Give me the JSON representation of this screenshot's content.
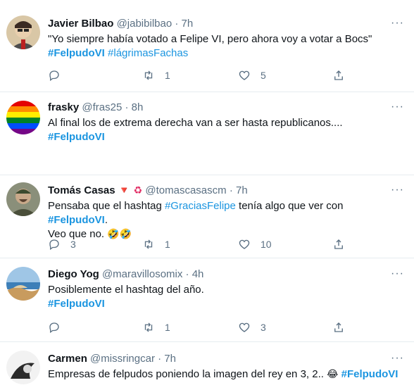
{
  "tweets": [
    {
      "name": "Javier Bilbao",
      "handle": "@jabibilbao",
      "time": "7h",
      "line1": "\"Yo siempre había votado a Felipe VI, pero ahora voy a votar a Bocs\"",
      "tag1": "#FelpudoVI",
      "tag2": "#lágrimasFachas",
      "reply_count": "",
      "retweet_count": "1",
      "like_count": "5"
    },
    {
      "name": "frasky",
      "handle": "@fras25",
      "time": "8h",
      "line1": "Al final los de extrema derecha van a ser hasta republicanos....",
      "tag1": "#FelpudoVI",
      "reply_count": "",
      "retweet_count": "",
      "like_count": ""
    },
    {
      "name": "Tomás Casas",
      "name_emojis": "🔻 ♻",
      "handle": "@tomascasascm",
      "time": "7h",
      "line1_pre": "Pensaba que el hashtag ",
      "tag_mid": "#GraciasFelipe",
      "line1_mid": " tenía algo que ver con ",
      "tag1": "#FelpudoVI",
      "line1_end": ".",
      "line2": "Veo que no. ",
      "line2_emoji": "🤣🤣",
      "reply_count": "3",
      "retweet_count": "1",
      "like_count": "10"
    },
    {
      "name": "Diego Yog",
      "handle": "@maravillosomix",
      "time": "4h",
      "line1": "Posiblemente el hashtag del año.",
      "tag1": "#FelpudoVI",
      "reply_count": "",
      "retweet_count": "1",
      "like_count": "3"
    },
    {
      "name": "Carmen",
      "handle": "@missringcar",
      "time": "7h",
      "line1": "Empresas de felpudos poniendo la imagen del rey en 3, 2.. ",
      "emoji": "😂",
      "tag1": "#FelpudoVI"
    }
  ],
  "ui": {
    "dot": "·",
    "more": "···"
  },
  "colors": {
    "link": "#1b95e0",
    "secondary": "#5b7083",
    "divider": "#e6ecf0"
  }
}
